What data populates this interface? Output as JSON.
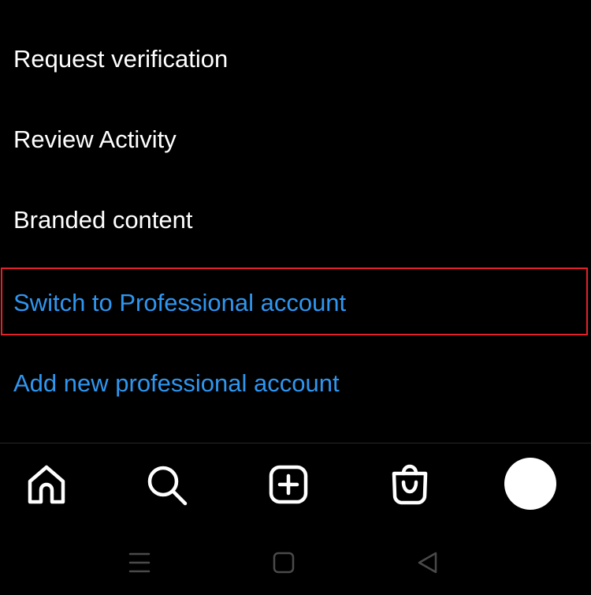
{
  "menu": {
    "items": [
      {
        "label": "Request verification",
        "style": "white"
      },
      {
        "label": "Review Activity",
        "style": "white"
      },
      {
        "label": "Branded content",
        "style": "white"
      },
      {
        "label": "Switch to Professional account",
        "style": "blue",
        "highlighted": true
      },
      {
        "label": "Add new professional account",
        "style": "blue"
      }
    ]
  },
  "colors": {
    "background": "#000000",
    "text_primary": "#ffffff",
    "link_blue": "#2f96f0",
    "highlight_red": "#e3212b",
    "divider": "#262626",
    "system_nav_icon": "#4a4a4a"
  },
  "tab_bar": {
    "icons": [
      "home-icon",
      "search-icon",
      "create-post-icon",
      "shop-icon",
      "profile-avatar"
    ]
  },
  "system_nav": {
    "icons": [
      "recent-apps-icon",
      "home-button-icon",
      "back-icon"
    ]
  }
}
